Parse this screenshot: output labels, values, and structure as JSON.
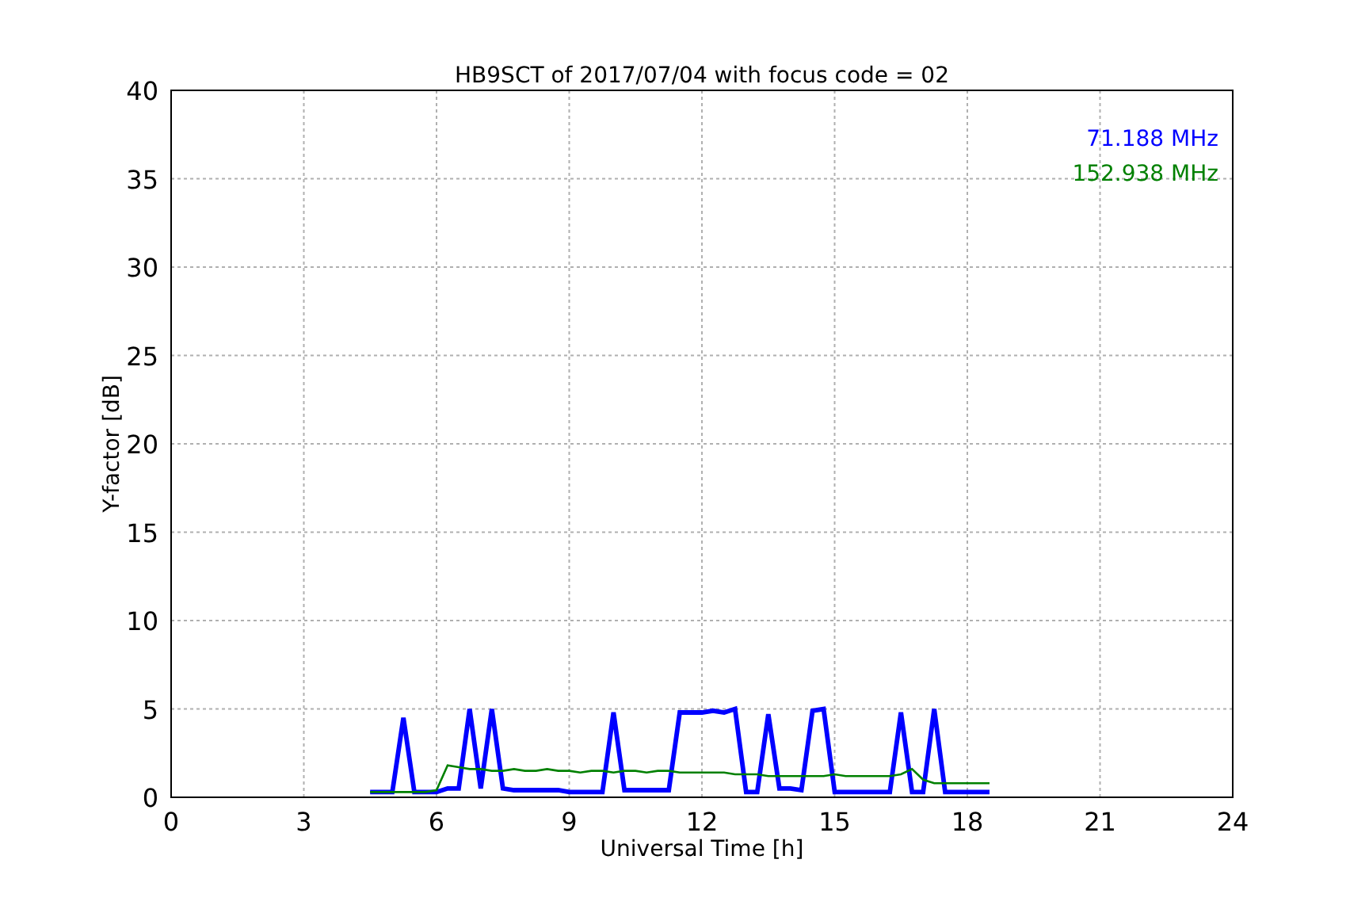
{
  "chart_data": {
    "type": "line",
    "title": "HB9SCT of 2017/07/04 with focus code = 02",
    "xlabel": "Universal Time [h]",
    "ylabel": "Y-factor [dB]",
    "xlim": [
      0,
      24
    ],
    "ylim": [
      0,
      40
    ],
    "xticks": [
      0,
      3,
      6,
      9,
      12,
      15,
      18,
      21,
      24
    ],
    "yticks": [
      0,
      5,
      10,
      15,
      20,
      25,
      30,
      35,
      40
    ],
    "grid": true,
    "x": [
      4.5,
      4.75,
      5,
      5.25,
      5.5,
      5.75,
      6,
      6.25,
      6.5,
      6.75,
      7,
      7.25,
      7.5,
      7.75,
      8,
      8.25,
      8.5,
      8.75,
      9,
      9.25,
      9.5,
      9.75,
      10,
      10.25,
      10.5,
      10.75,
      11,
      11.25,
      11.5,
      11.75,
      12,
      12.25,
      12.5,
      12.75,
      13,
      13.25,
      13.5,
      13.75,
      14,
      14.25,
      14.5,
      14.75,
      15,
      15.25,
      15.5,
      15.75,
      16,
      16.25,
      16.5,
      16.75,
      17,
      17.25,
      17.5,
      17.75,
      18,
      18.25,
      18.5
    ],
    "series": [
      {
        "name": "71.188 MHz",
        "color": "#0000ff",
        "values": [
          0.3,
          0.3,
          0.3,
          4.5,
          0.3,
          0.3,
          0.3,
          0.5,
          0.5,
          5.0,
          0.5,
          5.0,
          0.5,
          0.4,
          0.4,
          0.4,
          0.4,
          0.4,
          0.3,
          0.3,
          0.3,
          0.3,
          4.8,
          0.4,
          0.4,
          0.4,
          0.4,
          0.4,
          4.8,
          4.8,
          4.8,
          4.9,
          4.8,
          5.0,
          0.3,
          0.3,
          4.7,
          0.5,
          0.5,
          0.4,
          4.9,
          5.0,
          0.3,
          0.3,
          0.3,
          0.3,
          0.3,
          0.3,
          4.8,
          0.3,
          0.3,
          5.0,
          0.3,
          0.3,
          0.3,
          0.3,
          0.3
        ]
      },
      {
        "name": "152.938 MHz",
        "color": "#008000",
        "values": [
          0.3,
          0.3,
          0.3,
          0.3,
          0.3,
          0.3,
          0.4,
          1.8,
          1.7,
          1.6,
          1.6,
          1.5,
          1.5,
          1.6,
          1.5,
          1.5,
          1.6,
          1.5,
          1.5,
          1.4,
          1.5,
          1.5,
          1.4,
          1.5,
          1.5,
          1.4,
          1.5,
          1.5,
          1.4,
          1.4,
          1.4,
          1.4,
          1.4,
          1.3,
          1.3,
          1.3,
          1.2,
          1.2,
          1.2,
          1.2,
          1.2,
          1.2,
          1.3,
          1.2,
          1.2,
          1.2,
          1.2,
          1.2,
          1.3,
          1.6,
          1.0,
          0.8,
          0.8,
          0.8,
          0.8,
          0.8,
          0.8
        ]
      }
    ]
  }
}
